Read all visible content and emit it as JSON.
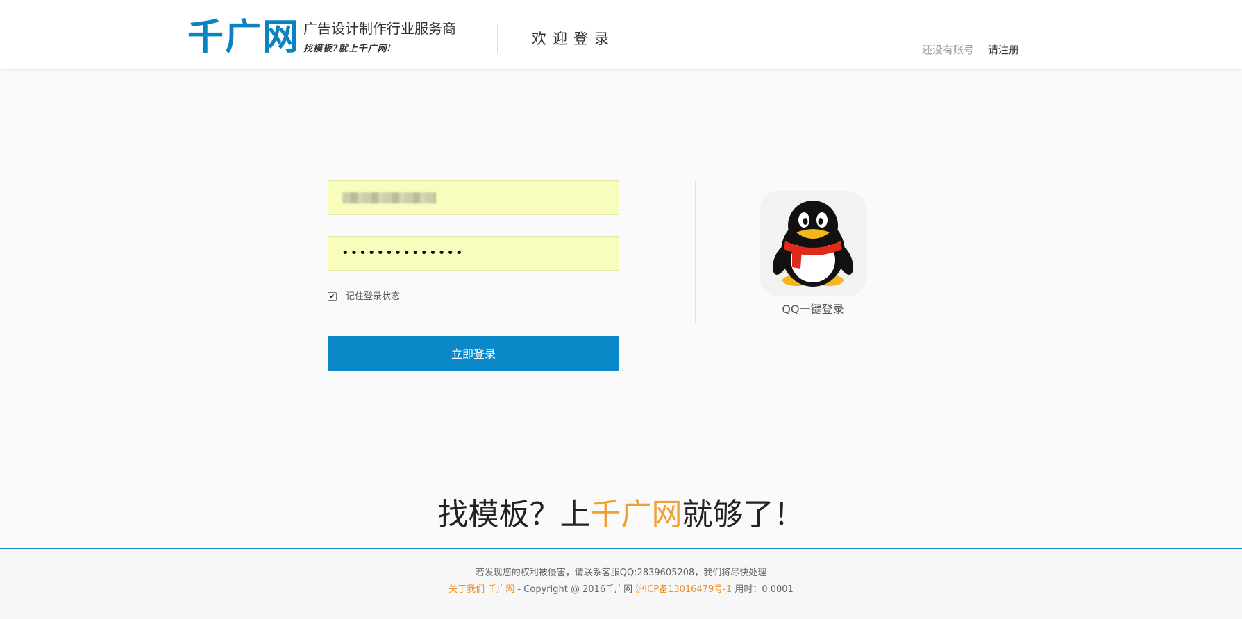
{
  "header": {
    "logo_text": "千广网",
    "tagline_main": "广告设计制作行业服务商",
    "tagline_sub": "找模板?就上千广网!",
    "welcome_text": "欢迎登录",
    "register_prompt": "还没有账号",
    "register_link": "请注册"
  },
  "login_form": {
    "username_value": "",
    "password_mask": "••••••••••••••",
    "remember_checked": true,
    "remember_label": "记住登录状态",
    "submit_label": "立即登录"
  },
  "qq_login": {
    "label": "QQ一键登录",
    "icon": "qq-penguin-icon"
  },
  "slogan": {
    "part1": "找模板？上",
    "highlight": "千广网",
    "part2": "就够了！"
  },
  "footer": {
    "notice": "若发现您的权利被侵害，请联系客服QQ:2839605208，我们将尽快处理",
    "about_link": "关于我们",
    "site_link": "千广网",
    "copyright": " - Copyright @ 2016千广网 ",
    "icp_link": "沪ICP备13016479号-1",
    "timing": " 用时：0.0001"
  },
  "colors": {
    "brand_blue": "#0b82c2",
    "button_blue": "#0b88c8",
    "highlight_orange": "#f0a032",
    "input_bg": "#f8fcbc"
  }
}
